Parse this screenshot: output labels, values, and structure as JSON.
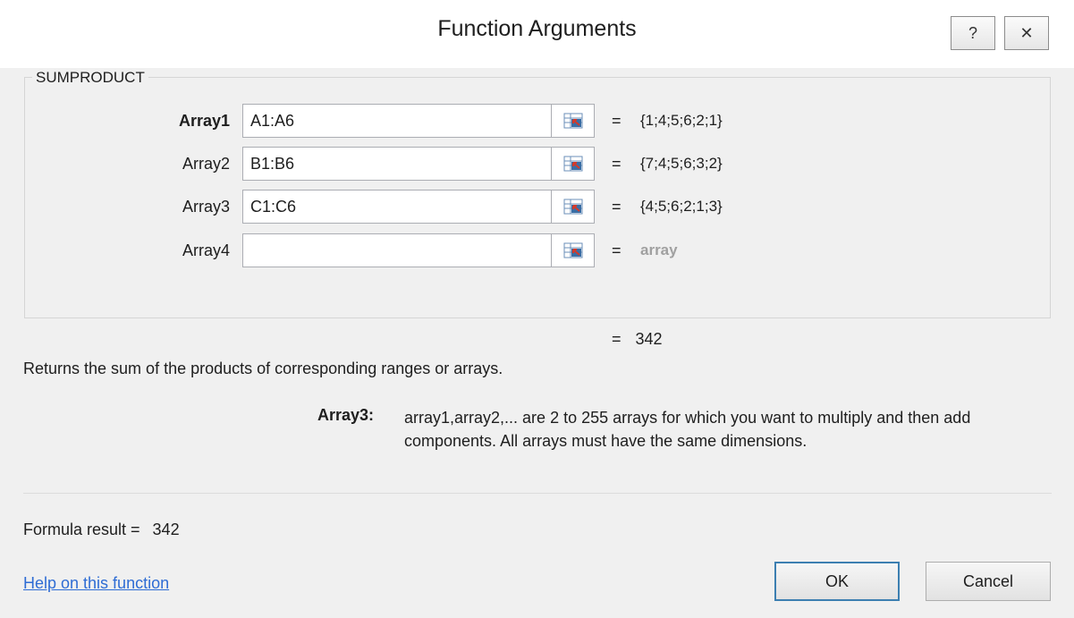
{
  "window": {
    "title": "Function Arguments",
    "help_glyph": "?",
    "close_glyph": "✕"
  },
  "function": {
    "name": "SUMPRODUCT",
    "arguments": [
      {
        "label": "Array1",
        "value": "A1:A6",
        "equals": "=",
        "result": "{1;4;5;6;2;1}"
      },
      {
        "label": "Array2",
        "value": "B1:B6",
        "equals": "=",
        "result": "{7;4;5;6;3;2}"
      },
      {
        "label": "Array3",
        "value": "C1:C6",
        "equals": "=",
        "result": "{4;5;6;2;1;3}"
      },
      {
        "label": "Array4",
        "value": "",
        "equals": "=",
        "result": "array"
      }
    ],
    "result_equals": "=",
    "result_value": "342",
    "description": "Returns the sum of the products of corresponding ranges or arrays.",
    "arg_help_name": "Array3:",
    "arg_help_text": "array1,array2,... are 2 to 255 arrays for which you want to multiply and then add components. All arrays must have the same dimensions."
  },
  "footer": {
    "formula_result_label": "Formula result =",
    "formula_result_value": "342",
    "help_link": "Help on this function",
    "ok_label": "OK",
    "cancel_label": "Cancel"
  },
  "icons": {
    "help": "help-icon",
    "close": "close-icon",
    "range_select": "collapse-dialog-icon"
  },
  "colors": {
    "link": "#2e6cd4",
    "placeholder": "#a0a0a0",
    "ok_border": "#3c7fb1"
  }
}
